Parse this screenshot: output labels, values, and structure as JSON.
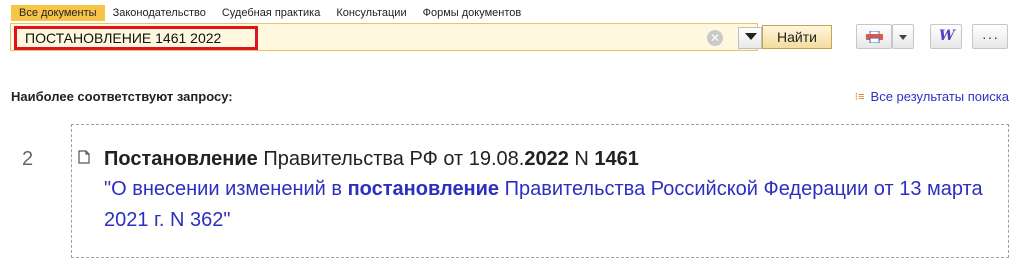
{
  "tabs": [
    "Все документы",
    "Законодательство",
    "Судебная практика",
    "Консультации",
    "Формы документов"
  ],
  "search": {
    "query": "ПОСТАНОВЛЕНИЕ 1461 2022",
    "find_label": "Найти"
  },
  "toolbar": {
    "print_icon": "printer-icon",
    "word_icon": "W",
    "more_icon": "···"
  },
  "results": {
    "heading": "Наиболее соответствуют запросу:",
    "all_results_label": "Все результаты поиска",
    "items": [
      {
        "number": "2",
        "title_parts": [
          "Постановление",
          " Правительства РФ от 19.08.",
          "2022",
          " N ",
          "1461"
        ],
        "desc_parts": [
          "\"О внесении изменений в ",
          "постановление",
          " Правительства Российской Федерации от 13 марта 2021 г. N 362\""
        ]
      }
    ]
  },
  "colors": {
    "active_tab": "#f7c447",
    "highlight_border": "#e0141e",
    "link": "#2c2fbf"
  }
}
